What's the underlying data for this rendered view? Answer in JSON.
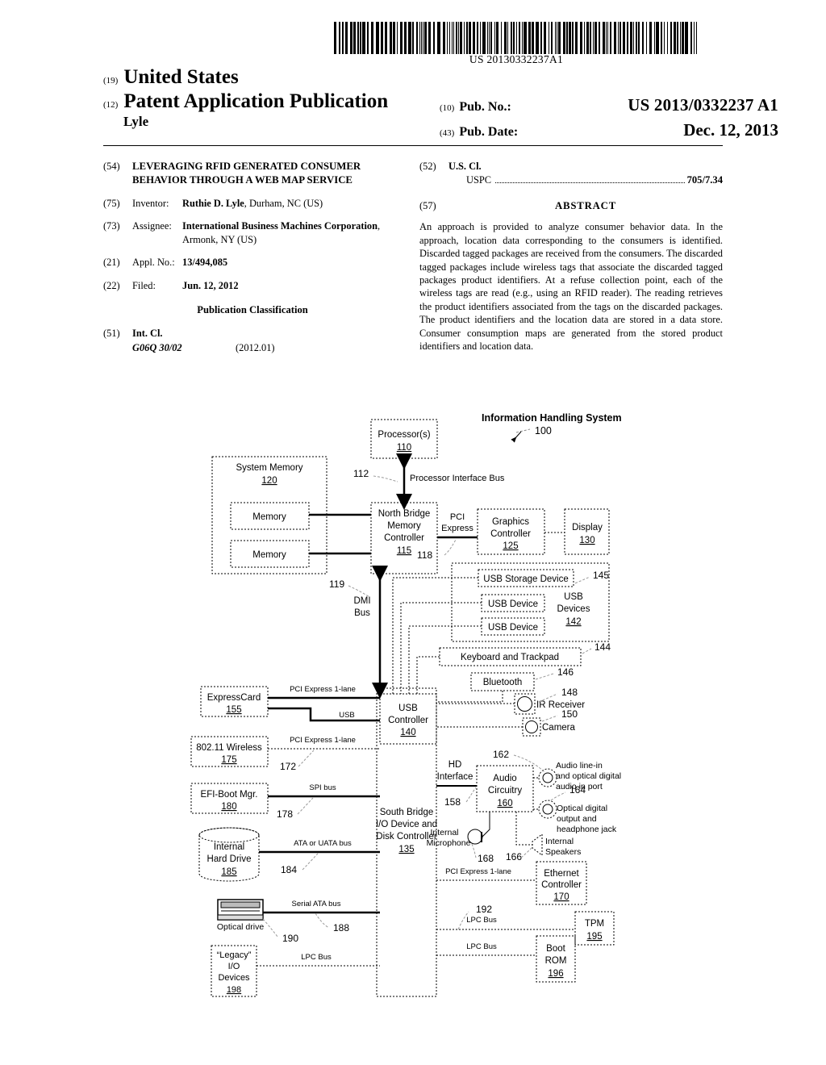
{
  "header": {
    "barcode_text": "US 20130332237A1",
    "country_code_num": "(19)",
    "country": "United States",
    "doc_type_num": "(12)",
    "doc_type": "Patent Application Publication",
    "inventor_surname": "Lyle",
    "pub_no_num": "(10)",
    "pub_no_label": "Pub. No.:",
    "pub_no_value": "US 2013/0332237 A1",
    "pub_date_num": "(43)",
    "pub_date_label": "Pub. Date:",
    "pub_date_value": "Dec. 12, 2013"
  },
  "biblio": {
    "title_num": "(54)",
    "title": "LEVERAGING RFID GENERATED CONSUMER BEHAVIOR THROUGH A WEB MAP SERVICE",
    "inventor_num": "(75)",
    "inventor_label": "Inventor:",
    "inventor_name": "Ruthie D. Lyle",
    "inventor_addr": ", Durham, NC (US)",
    "assignee_num": "(73)",
    "assignee_label": "Assignee:",
    "assignee_name": "International Business Machines Corporation",
    "assignee_addr": ", Armonk, NY (US)",
    "appl_num": "(21)",
    "appl_label": "Appl. No.:",
    "appl_value": "13/494,085",
    "filed_num": "(22)",
    "filed_label": "Filed:",
    "filed_value": "Jun. 12, 2012",
    "pub_class_head": "Publication Classification",
    "intcl_num": "(51)",
    "intcl_label": "Int. Cl.",
    "intcl_code": "G06Q 30/02",
    "intcl_version": "(2012.01)"
  },
  "right_col": {
    "uscl_num": "(52)",
    "uscl_label": "U.S. Cl.",
    "uspc_label": "USPC",
    "uspc_value": "705/7.34",
    "abstract_num": "(57)",
    "abstract_head": "ABSTRACT",
    "abstract_text": "An approach is provided to analyze consumer behavior data. In the approach, location data corresponding to the consumers is identified. Discarded tagged packages are received from the consumers. The discarded tagged packages include wireless tags that associate the discarded tagged packages product identifiers. At a refuse collection point, each of the wireless tags are read (e.g., using an RFID reader). The reading retrieves the product identifiers associated from the tags on the discarded packages. The product identifiers and the location data are stored in a data store. Consumer consumption maps are generated from the stored product identifiers and location data."
  },
  "figure": {
    "title": "Information Handling System",
    "title_ref": "100",
    "blocks": {
      "processor": {
        "label": "Processor(s)",
        "ref": "110"
      },
      "system_memory": {
        "label": "System Memory",
        "ref": "120"
      },
      "memory1": {
        "label": "Memory"
      },
      "memory2": {
        "label": "Memory"
      },
      "north_bridge": {
        "label": "North Bridge Memory Controller",
        "ref": "115"
      },
      "graphics": {
        "label": "Graphics Controller",
        "ref": "125"
      },
      "display": {
        "label": "Display",
        "ref": "130"
      },
      "usb_storage": {
        "label": "USB Storage Device",
        "ref": "145"
      },
      "usb_device1": {
        "label": "USB Device"
      },
      "usb_device2": {
        "label": "USB Device"
      },
      "usb_devices_group": {
        "label": "USB Devices",
        "ref": "142"
      },
      "keyboard": {
        "label": "Keyboard and Trackpad",
        "ref": "144"
      },
      "bluetooth": {
        "label": "Bluetooth",
        "ref": "146"
      },
      "ir_receiver": {
        "label": "IR Receiver",
        "ref": "148"
      },
      "camera": {
        "label": "Camera",
        "ref": "150"
      },
      "usb_controller": {
        "label": "USB Controller",
        "ref": "140"
      },
      "expresscard": {
        "label": "ExpressCard",
        "ref": "155"
      },
      "wireless": {
        "label": "802.11 Wireless",
        "ref": "175"
      },
      "efi_boot": {
        "label": "EFI-Boot Mgr.",
        "ref": "180"
      },
      "hard_drive": {
        "label": "Internal Hard Drive",
        "ref": "185"
      },
      "optical_drive": {
        "label": "Optical drive",
        "ref": "190"
      },
      "legacy_io": {
        "label": "“Legacy” I/O Devices",
        "ref": "198"
      },
      "south_bridge": {
        "label": "South Bridge I/O Device and Disk Controller",
        "ref": "135"
      },
      "audio": {
        "label": "Audio Circuitry",
        "ref": "160"
      },
      "hd_interface": {
        "label": "HD Interface",
        "ref": "158"
      },
      "line_in": {
        "label": "Audio line-in and optical digital audio in port",
        "ref": "162"
      },
      "optical_out": {
        "label": "Optical digital output and headphone jack",
        "ref": "164"
      },
      "internal_mic": {
        "label": "Internal Microphone",
        "ref": "168"
      },
      "internal_speakers": {
        "label": "Internal Speakers",
        "ref": "166"
      },
      "ethernet": {
        "label": "Ethernet Controller",
        "ref": "170"
      },
      "tpm": {
        "label": "TPM",
        "ref": "195"
      },
      "boot_rom": {
        "label": "Boot ROM",
        "ref": "196"
      }
    },
    "buses": {
      "processor_interface": {
        "label": "Processor Interface Bus",
        "ref": "112"
      },
      "pci_express_nb": {
        "label": "PCI Express",
        "ref": "118"
      },
      "dmi": {
        "label": "DMI Bus",
        "ref": "119"
      },
      "pcie_expresscard": {
        "label": "PCI Express 1-lane"
      },
      "usb_expresscard": {
        "label": "USB"
      },
      "pcie_wireless": {
        "label": "PCI Express 1-lane",
        "ref": "172"
      },
      "spi": {
        "label": "SPI bus",
        "ref": "178"
      },
      "ata": {
        "label": "ATA or UATA bus",
        "ref": "184"
      },
      "sata": {
        "label": "Serial ATA bus",
        "ref": "188"
      },
      "lpc_legacy": {
        "label": "LPC Bus"
      },
      "pcie_ethernet": {
        "label": "PCI Express 1-lane"
      },
      "lpc_tpm": {
        "label": "LPC Bus",
        "ref": "192"
      },
      "lpc_bootrom": {
        "label": "LPC Bus"
      }
    }
  }
}
